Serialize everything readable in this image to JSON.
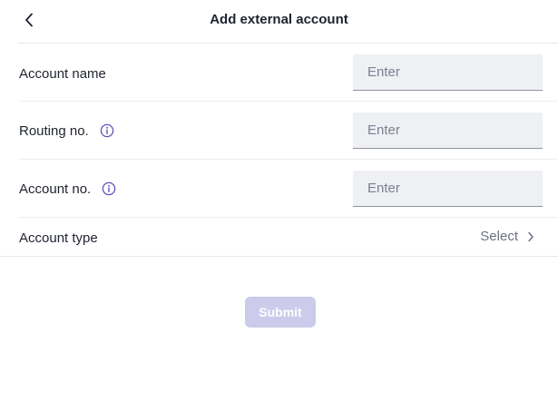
{
  "header": {
    "title": "Add external account",
    "back_icon": "chevron-left-icon"
  },
  "form": {
    "account_name": {
      "label": "Account name",
      "placeholder": "Enter",
      "value": ""
    },
    "routing_no": {
      "label": "Routing no.",
      "placeholder": "Enter",
      "value": "",
      "info_icon": "info-icon"
    },
    "account_no": {
      "label": "Account no.",
      "placeholder": "Enter",
      "value": "",
      "info_icon": "info-icon"
    },
    "account_type": {
      "label": "Account type",
      "select_text": "Select",
      "chevron_icon": "chevron-right-icon"
    }
  },
  "submit": {
    "label": "Submit",
    "enabled": false
  },
  "colors": {
    "accent": "#5b55b8",
    "submit_disabled_bg": "#cdcbeb",
    "field_bg": "#eef0f4"
  }
}
